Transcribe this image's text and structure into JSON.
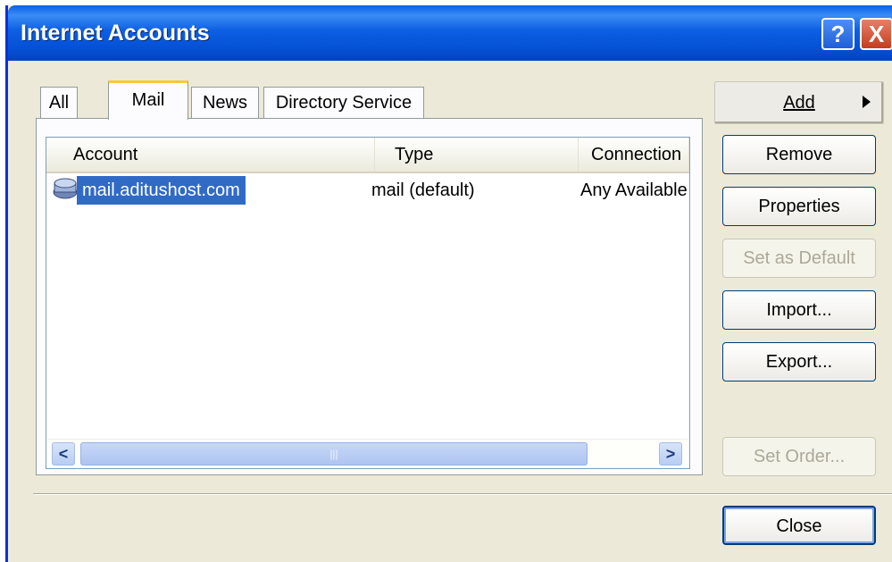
{
  "window": {
    "title": "Internet Accounts",
    "help_symbol": "?",
    "close_symbol": "X"
  },
  "tabs": [
    {
      "label": "All",
      "active": false
    },
    {
      "label": "Mail",
      "active": true
    },
    {
      "label": "News",
      "active": false
    },
    {
      "label": "Directory Service",
      "active": false
    }
  ],
  "list": {
    "columns": [
      "Account",
      "Type",
      "Connection"
    ],
    "rows": [
      {
        "account": "mail.aditushost.com",
        "type": "mail (default)",
        "connection": "Any Available",
        "selected": true,
        "icon": "mail-account-icon"
      }
    ],
    "scrollbar": {
      "left_symbol": "<",
      "right_symbol": ">",
      "grip": "|||"
    }
  },
  "buttons": {
    "add": "Add",
    "remove": "Remove",
    "properties": "Properties",
    "set_default": "Set as Default",
    "import": "Import...",
    "export": "Export...",
    "set_order": "Set Order...",
    "close": "Close"
  },
  "colors": {
    "titlebar": "#0a5fe8",
    "selection": "#316ac5",
    "dialog_bg": "#ece9d8",
    "tab_highlight": "#ffc83c"
  }
}
